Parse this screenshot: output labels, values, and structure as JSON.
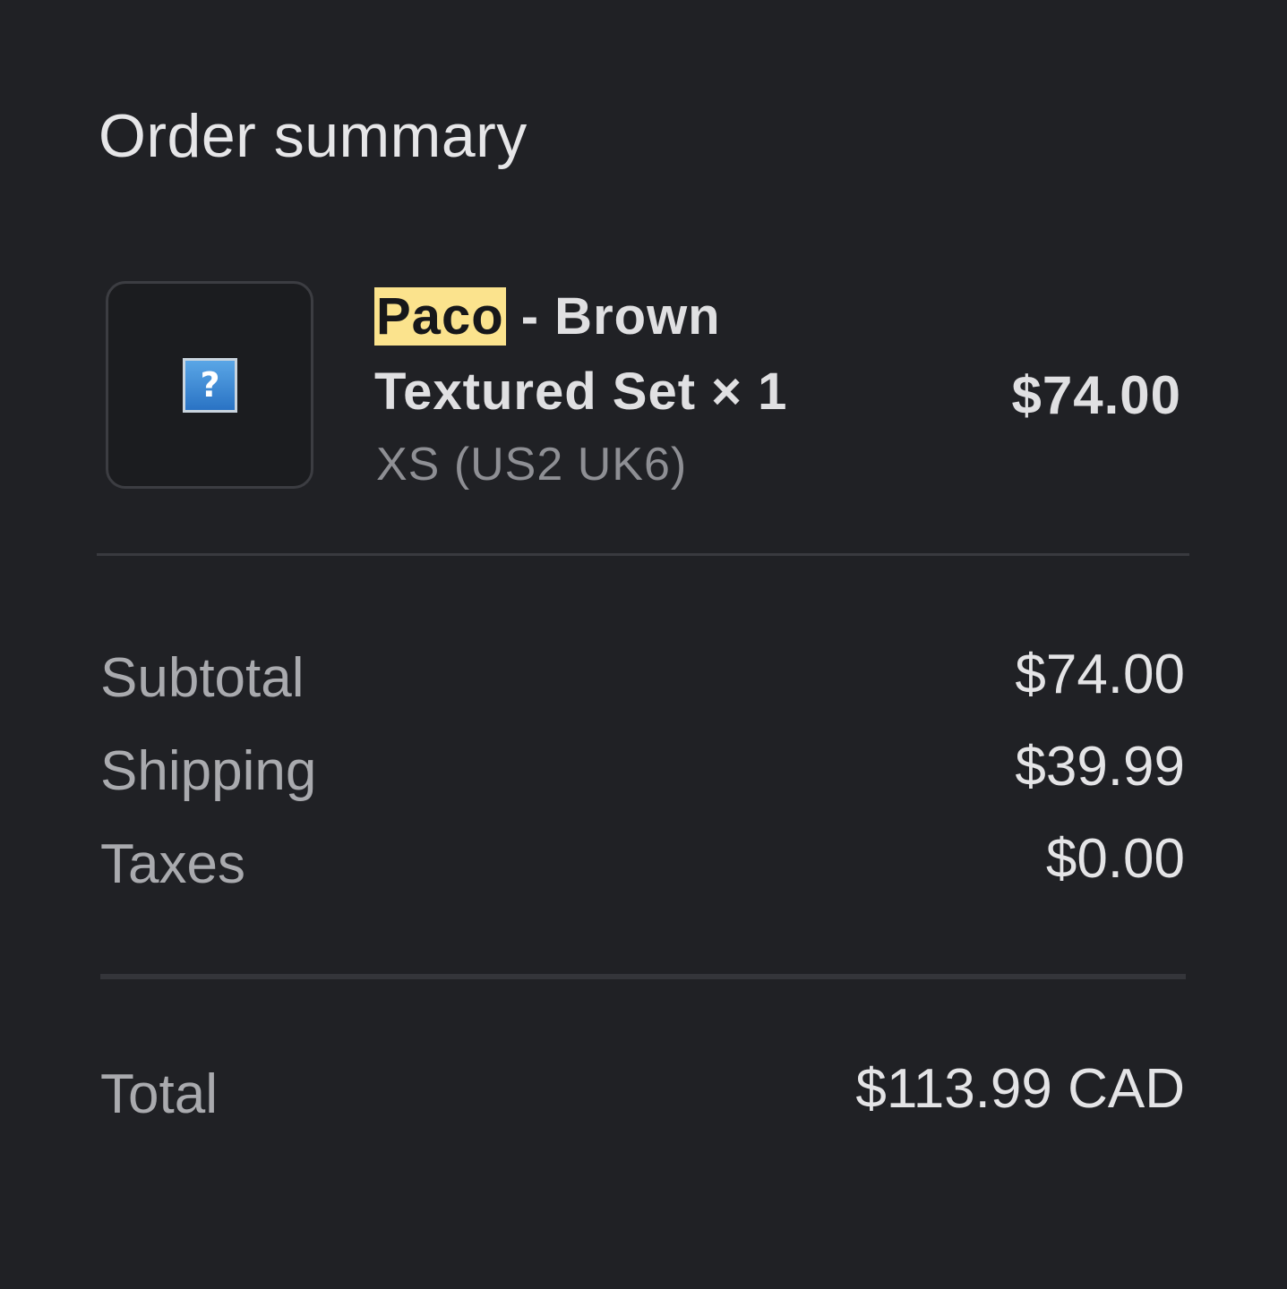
{
  "summary": {
    "title": "Order summary"
  },
  "item": {
    "image_icon": "missing-image-icon",
    "image_glyph": "?",
    "name_highlight": "Paco",
    "name_rest_line1": " - Brown",
    "name_line2": "Textured Set × 1",
    "variant": "XS (US2 UK6)",
    "price": "$74.00",
    "highlight_color": "#fbe38d"
  },
  "totals": {
    "subtotal_label": "Subtotal",
    "subtotal_value": "$74.00",
    "shipping_label": "Shipping",
    "shipping_value": "$39.99",
    "taxes_label": "Taxes",
    "taxes_value": "$0.00",
    "total_label": "Total",
    "total_value": "$113.99 CAD"
  }
}
